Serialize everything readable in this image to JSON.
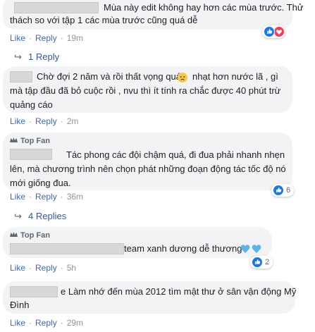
{
  "comments": [
    {
      "text_line1": "Mùa này edit không hay hơn các mùa trước. Thử",
      "text_line2": "thách so với tập 1 các mùa trước cũng quá dễ",
      "like": "Like",
      "reply": "Reply",
      "time": "19m",
      "reaction_icons": [
        "like-icon",
        "love-icon"
      ],
      "replies_label": "1 Reply"
    },
    {
      "text_line1": "Chờ đợi 2 năm và rồi thất vọng quá",
      "text_line1b": "nhạt hơn nước lã , gì",
      "text_line2": "mà tập đầu đã bỏ cuộc rồi , nvu thì ít tính ra chắc được 40 phút trừ",
      "text_line3": "quảng cáo",
      "like": "Like",
      "reply": "Reply",
      "time": "2m"
    },
    {
      "badge": "Top Fan",
      "text_line1": "Tác phong các đội chậm quá, đi đua phải nhanh nhẹn",
      "text_line2": "lên, mà chương trình nên chọn phát những đoạn động tác tốc độ nó",
      "text_line3": "mới giống đua.",
      "like": "Like",
      "reply": "Reply",
      "time": "36m",
      "reaction_count": "6",
      "replies_label": "4 Replies"
    },
    {
      "badge": "Top Fan",
      "text_line1": "team xanh dương dễ thương",
      "like": "Like",
      "reply": "Reply",
      "time": "5h",
      "reaction_count": "2"
    },
    {
      "text_line1": "e Làm nhớ đến mùa 2012 tìm mật thư ở sân vận động Mỹ",
      "text_line2": "Đình",
      "like": "Like",
      "reply": "Reply",
      "time": "29m"
    }
  ],
  "colors": {
    "link": "#4267b2",
    "bubble": "#f2f3f5",
    "like_blue": "#1877f2",
    "love_red": "#f33e58"
  }
}
